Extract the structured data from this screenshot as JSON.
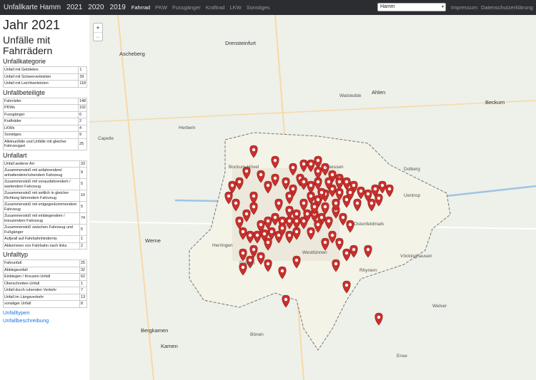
{
  "nav": {
    "brand": "Unfallkarte Hamm",
    "years": [
      "2021",
      "2020",
      "2019"
    ],
    "modes": [
      "Fahrrad",
      "PKW",
      "Fussgänger",
      "Kraftrad",
      "LKW",
      "Sonstiges"
    ],
    "city": "Hamm",
    "impressum": "Impressum",
    "privacy": "Datenschutzerklärung"
  },
  "sidebar": {
    "year_title": "Jahr 2021",
    "subtitle": "Unfälle mit Fahrrädern",
    "kategorie": {
      "title": "Unfallkategorie",
      "rows": [
        {
          "label": "Unfall mit Getöteten",
          "value": "1"
        },
        {
          "label": "Unfall mit Schwerverletzten",
          "value": "29"
        },
        {
          "label": "Unfall mit Leichtverletzten",
          "value": "118"
        }
      ]
    },
    "beteiligte": {
      "title": "Unfallbeteiligte",
      "rows": [
        {
          "label": "Fahrräder",
          "value": "148"
        },
        {
          "label": "PKWs",
          "value": "102"
        },
        {
          "label": "Fussgänger",
          "value": "6"
        },
        {
          "label": "Krafträder",
          "value": "2"
        },
        {
          "label": "LKWs",
          "value": "4"
        },
        {
          "label": "Sonstiges",
          "value": "9"
        },
        {
          "label": "Alleinunfälle und Unfälle mit gleicher Fahrzeugart",
          "value": "25"
        }
      ]
    },
    "art": {
      "title": "Unfallart",
      "rows": [
        {
          "label": "Unfall anderer Art",
          "value": "33"
        },
        {
          "label": "Zusammenstoß mit anfahrendem/ anhaltendem/ruhendem Fahrzeug",
          "value": "9"
        },
        {
          "label": "Zusammenstoß mit vorausfahrendem / wartendem Fahrzeug",
          "value": "5"
        },
        {
          "label": "Zusammenstoß mit seitlich in gleicher Richtung fahrendem Fahrzeug",
          "value": "10"
        },
        {
          "label": "Zusammenstoß mit entgegenkommendem Fahrzeug",
          "value": "5"
        },
        {
          "label": "Zusammenstoß mit einbiegendem / kreuzendem Fahrzeug",
          "value": "74"
        },
        {
          "label": "Zusammenstoß zwischen Fahrzeug und Fußgänger",
          "value": "5"
        },
        {
          "label": "Aufprall auf Fahrbahnhindernis",
          "value": "1"
        },
        {
          "label": "Abkommen von Fahrbahn nach links",
          "value": "2"
        }
      ]
    },
    "typ": {
      "title": "Unfalltyp",
      "rows": [
        {
          "label": "Fahrunfall",
          "value": "25"
        },
        {
          "label": "Abbiegeunfall",
          "value": "32"
        },
        {
          "label": "Einbiegen / Kreuzen-Unfall",
          "value": "62"
        },
        {
          "label": "Überschreiten-Unfall",
          "value": "1"
        },
        {
          "label": "Unfall durch ruhenden Verkehr",
          "value": "7"
        },
        {
          "label": "Unfall im Längsverkehr",
          "value": "13"
        },
        {
          "label": "sonstiger Unfall",
          "value": "8"
        }
      ]
    },
    "link_typen": "Unfalltypen",
    "link_beschreibung": "Unfallbeschreibung"
  },
  "map": {
    "zoom_in": "+",
    "zoom_out": "−",
    "labels": [
      {
        "text": "Drensteinfurt",
        "cls": "big"
      },
      {
        "text": "Ahlen",
        "cls": "big"
      },
      {
        "text": "Beckum",
        "cls": "big"
      },
      {
        "text": "Ascheberg",
        "cls": "big"
      },
      {
        "text": "Werne",
        "cls": "big"
      },
      {
        "text": "Bergkamen",
        "cls": "big"
      },
      {
        "text": "Kamen",
        "cls": "big"
      },
      {
        "text": "Welver",
        "cls": ""
      },
      {
        "text": "Bönen",
        "cls": ""
      },
      {
        "text": "Herbern",
        "cls": ""
      },
      {
        "text": "Capelle",
        "cls": ""
      },
      {
        "text": "Walstedde",
        "cls": ""
      },
      {
        "text": "Dolberg",
        "cls": ""
      },
      {
        "text": "Heessen",
        "cls": ""
      },
      {
        "text": "Bockum-Hövel",
        "cls": ""
      },
      {
        "text": "Pelkum",
        "cls": ""
      },
      {
        "text": "Rhynern",
        "cls": ""
      },
      {
        "text": "Uentrop",
        "cls": ""
      },
      {
        "text": "Herringen",
        "cls": ""
      },
      {
        "text": "Westtünnen",
        "cls": ""
      },
      {
        "text": "Ostenfeldmark",
        "cls": ""
      },
      {
        "text": "Vöckinghausen",
        "cls": ""
      },
      {
        "text": "Ense",
        "cls": ""
      }
    ],
    "marker_color": "#c9302c"
  }
}
